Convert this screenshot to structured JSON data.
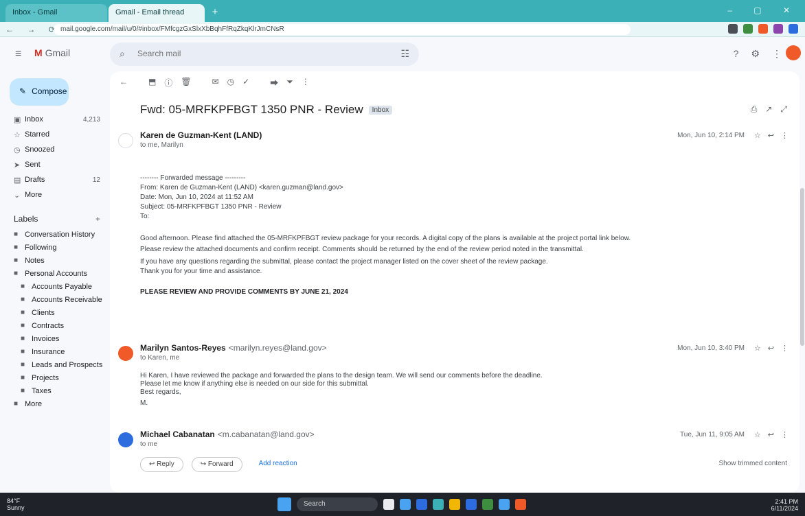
{
  "browser": {
    "tabs": [
      {
        "label": "Inbox - Gmail"
      },
      {
        "label": "Gmail - Email thread"
      }
    ],
    "new_tab": "+",
    "window_controls": "– ▢ ✕",
    "nav": "← → ⟳",
    "url": "mail.google.com/mail/u/0/#inbox/FMfcgzGxSlxXbBqhFfRqZkqKlrJmCNsR",
    "extension_colors": [
      "#4a4f55",
      "#3d8f3f",
      "#f05a28",
      "#8e44ad",
      "#2d6cdf"
    ]
  },
  "header": {
    "menu_icon": "menu-icon",
    "logo_prefix": "M",
    "logo_text": "Gmail",
    "search_placeholder": "Search mail",
    "icons": [
      "help-icon",
      "settings-icon",
      "apps-icon"
    ],
    "avatar_color": "#f05a28"
  },
  "nav": {
    "compose_label": "Compose",
    "items": [
      {
        "label": "Inbox",
        "icon": "▣",
        "count": "4,213"
      },
      {
        "label": "Starred",
        "icon": "☆",
        "count": ""
      },
      {
        "label": "Snoozed",
        "icon": "◷",
        "count": ""
      },
      {
        "label": "Sent",
        "icon": "➤",
        "count": ""
      },
      {
        "label": "Drafts",
        "icon": "▤",
        "count": "12"
      },
      {
        "label": "More",
        "icon": "⌄",
        "count": ""
      }
    ],
    "labels_header": "Labels",
    "labels_plus": "+",
    "labels": [
      {
        "label": "Conversation History"
      },
      {
        "label": "Following"
      },
      {
        "label": "Notes"
      },
      {
        "label": "Personal Accounts"
      },
      {
        "label": "Accounts Payable"
      },
      {
        "label": "Accounts Receivable"
      },
      {
        "label": "Clients"
      },
      {
        "label": "Contracts"
      },
      {
        "label": "Invoices"
      },
      {
        "label": "Insurance"
      },
      {
        "label": "Leads and Prospects"
      },
      {
        "label": "Projects"
      },
      {
        "label": "Taxes"
      },
      {
        "label": "More"
      }
    ]
  },
  "toolbar": {
    "icons": [
      "←",
      "⬒",
      "ⓘ",
      "🗑",
      "✉",
      "◷",
      "✓",
      "⮕",
      "⏷",
      "⋮"
    ]
  },
  "thread": {
    "subject": "Fwd: 05-MRFKPFBGT 1350 PNR - Review",
    "subject_chip": "Inbox",
    "subject_icons": [
      "⎙",
      "↗",
      "⤢"
    ],
    "messages": [
      {
        "from": "Karen de Guzman-Kent (LAND)",
        "addr": "",
        "to": "to me, Marilyn",
        "date": "Mon, Jun 10, 2:14 PM",
        "avatar_color": "#ffffff",
        "lines": [
          {
            "text": "-------- Forwarded message ---------",
            "bold": false
          },
          {
            "text": "From: Karen de Guzman-Kent (LAND) <karen.guzman@land.gov>",
            "bold": false
          },
          {
            "text": "Date: Mon, Jun 10, 2024 at 11:52 AM",
            "bold": false
          },
          {
            "text": "Subject: 05-MRFKPFBGT 1350 PNR - Review",
            "bold": false
          },
          {
            "text": "To:",
            "bold": false
          },
          {
            "text": "Good afternoon. Please find attached the 05-MRFKPFBGT review package for your records. A digital copy of the plans is available at the project portal link below.",
            "bold": false
          },
          {
            "text": "Please review the attached documents and confirm receipt. Comments should be returned by the end of the review period noted in the transmittal.",
            "bold": false
          },
          {
            "text": "If you have any questions regarding the submittal, please contact the project manager listed on the cover sheet of the review package.",
            "bold": false
          },
          {
            "text": "Thank you for your time and assistance.",
            "bold": false
          },
          {
            "text": "PLEASE REVIEW AND PROVIDE COMMENTS BY JUNE 21, 2024",
            "bold": true
          }
        ]
      },
      {
        "from": "Marilyn Santos-Reyes",
        "addr": "<marilyn.reyes@land.gov>",
        "to": "to Karen, me",
        "date": "Mon, Jun 10, 3:40 PM",
        "avatar_color": "#f05a28",
        "lines": [
          {
            "text": "Hi Karen, I have reviewed the package and forwarded the plans to the design team. We will send our comments before the deadline.",
            "bold": false
          },
          {
            "text": "Please let me know if anything else is needed on our side for this submittal.",
            "bold": false
          },
          {
            "text": "Best regards,",
            "bold": false
          },
          {
            "text": "M.",
            "bold": false
          }
        ]
      },
      {
        "from": "Michael Cabanatan",
        "addr": "<m.cabanatan@land.gov>",
        "to": "to me",
        "date": "Tue, Jun 11, 9:05 AM",
        "avatar_color": "#2d6cdf",
        "lines": []
      }
    ],
    "reply_buttons": [
      "↩ Reply",
      "↪ Forward",
      "Add reaction"
    ],
    "reply_right": "Show trimmed content"
  },
  "taskbar": {
    "weather_temp": "84°F",
    "weather_text": "Sunny",
    "search": "Search",
    "app_colors": [
      "#e8eaed",
      "#4aa3f0",
      "#2d6cdf",
      "#3bb0b6",
      "#f2b705",
      "#2d6cdf",
      "#3d8f3f",
      "#4aa3f0",
      "#f05a28"
    ],
    "time": "2:41 PM",
    "date": "6/11/2024"
  }
}
